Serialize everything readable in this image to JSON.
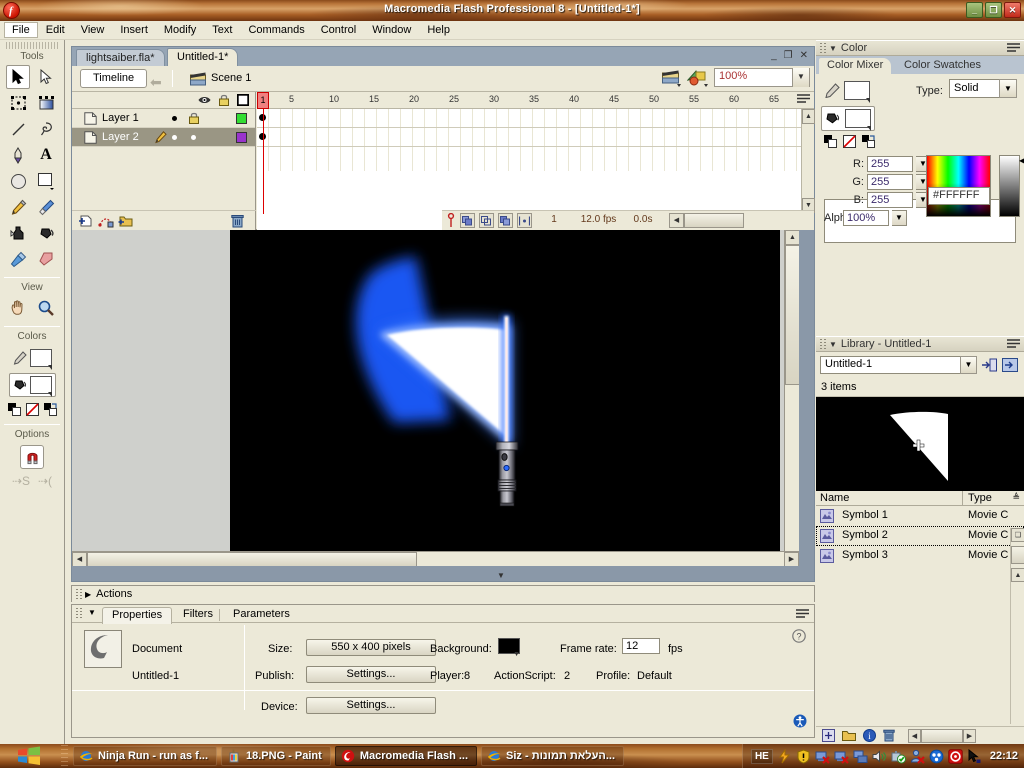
{
  "window": {
    "title": "Macromedia Flash Professional 8 - [Untitled-1*]",
    "minimize": "_",
    "maximize": "❐",
    "close": "✕"
  },
  "menubar": {
    "items": [
      "File",
      "Edit",
      "View",
      "Insert",
      "Modify",
      "Text",
      "Commands",
      "Control",
      "Window",
      "Help"
    ]
  },
  "tools": {
    "section_tools": "Tools",
    "section_view": "View",
    "section_colors": "Colors",
    "section_options": "Options",
    "items": [
      {
        "name": "selection-tool",
        "selected": true
      },
      {
        "name": "subselection-tool",
        "selected": false
      },
      {
        "name": "free-transform-tool",
        "selected": false
      },
      {
        "name": "gradient-transform-tool",
        "selected": false
      },
      {
        "name": "line-tool",
        "selected": false
      },
      {
        "name": "lasso-tool",
        "selected": false
      },
      {
        "name": "pen-tool",
        "selected": false
      },
      {
        "name": "text-tool",
        "selected": false
      },
      {
        "name": "oval-tool",
        "selected": false
      },
      {
        "name": "rectangle-tool",
        "selected": false
      },
      {
        "name": "pencil-tool",
        "selected": false
      },
      {
        "name": "brush-tool",
        "selected": false
      },
      {
        "name": "ink-bottle-tool",
        "selected": false
      },
      {
        "name": "paint-bucket-tool",
        "selected": false
      },
      {
        "name": "eyedropper-tool",
        "selected": false
      },
      {
        "name": "eraser-tool",
        "selected": false
      }
    ],
    "view_items": [
      {
        "name": "hand-tool"
      },
      {
        "name": "zoom-tool"
      }
    ],
    "stroke_color": "#FFFFFF",
    "fill_color": "#FFFFFF",
    "options": [
      {
        "name": "snap-to-objects-toggle",
        "active": true
      }
    ]
  },
  "document": {
    "tabs": [
      {
        "label": "lightsaiber.fla*",
        "active": false
      },
      {
        "label": "Untitled-1*",
        "active": true
      }
    ],
    "timeline_button": "Timeline",
    "scene_label": "Scene 1",
    "zoom": "100%",
    "win_minimize": "_",
    "win_restore": "❐",
    "win_close": "✕"
  },
  "timeline": {
    "layers": [
      {
        "name": "Layer 1",
        "selected": false,
        "locked": true,
        "color": "#33dd33"
      },
      {
        "name": "Layer 2",
        "selected": true,
        "locked": false,
        "color": "#9933cc"
      }
    ],
    "ruler_ticks": [
      1,
      5,
      10,
      15,
      20,
      25,
      30,
      35,
      40,
      45,
      50,
      55,
      60,
      65
    ],
    "current_frame": "1",
    "fps": "12.0 fps",
    "elapsed": "0.0s",
    "playhead_frame": "1",
    "footer_buttons": [
      "insert-layer",
      "add-motion-guide",
      "insert-folder",
      "delete-layer"
    ],
    "status_buttons": [
      "onion-skin",
      "onion-skin-outlines",
      "edit-multiple-frames",
      "modify-onion-markers"
    ]
  },
  "stage": {
    "background": "#000000",
    "artwork": "lightsaber-with-motion-blur-swipe"
  },
  "actions_panel": {
    "title": "Actions",
    "collapsed": true
  },
  "properties": {
    "tabs": [
      {
        "label": "Properties",
        "active": true
      },
      {
        "label": "Filters",
        "active": false
      },
      {
        "label": "Parameters",
        "active": false
      }
    ],
    "doc_type": "Document",
    "doc_name": "Untitled-1",
    "size_label": "Size:",
    "size_value": "550 x 400 pixels",
    "publish_label": "Publish:",
    "publish_value": "Settings...",
    "device_label": "Device:",
    "device_value": "Settings...",
    "background_label": "Background:",
    "background_color": "#000000",
    "framerate_label": "Frame rate:",
    "framerate_value": "12",
    "fps_unit": "fps",
    "player_label": "Player:",
    "player_value": "8",
    "actionscript_label": "ActionScript:",
    "actionscript_value": "2",
    "profile_label": "Profile:",
    "profile_value": "Default"
  },
  "color_panel": {
    "title": "Color",
    "tabs": [
      {
        "label": "Color Mixer",
        "active": true
      },
      {
        "label": "Color Swatches",
        "active": false
      }
    ],
    "type_label": "Type:",
    "type_value": "Solid",
    "r_label": "R:",
    "r_value": "255",
    "g_label": "G:",
    "g_value": "255",
    "b_label": "B:",
    "b_value": "255",
    "alpha_label": "Alpha:",
    "alpha_value": "100%",
    "hex_value": "#FFFFFF"
  },
  "library_panel": {
    "title": "Library - Untitled-1",
    "selector_value": "Untitled-1",
    "item_count": "3 items",
    "columns": [
      "Name",
      "Type"
    ],
    "items": [
      {
        "name": "Symbol 1",
        "type": "Movie C",
        "selected": false
      },
      {
        "name": "Symbol 2",
        "type": "Movie C",
        "selected": true
      },
      {
        "name": "Symbol 3",
        "type": "Movie C",
        "selected": false
      }
    ],
    "footer_buttons": [
      "new-symbol",
      "new-folder",
      "properties",
      "delete"
    ]
  },
  "taskbar": {
    "start_label": "start",
    "items": [
      {
        "label": "Ninja Run - run as f...",
        "icon": "internet-explorer-icon",
        "active": false
      },
      {
        "label": "18.PNG - Paint",
        "icon": "paint-icon",
        "active": false
      },
      {
        "label": "Macromedia Flash ...",
        "icon": "flash-icon",
        "active": true
      },
      {
        "label": "Siz - העלאת תמונות...",
        "icon": "internet-explorer-icon",
        "active": false
      }
    ],
    "language": "HE",
    "clock": "22:12"
  }
}
